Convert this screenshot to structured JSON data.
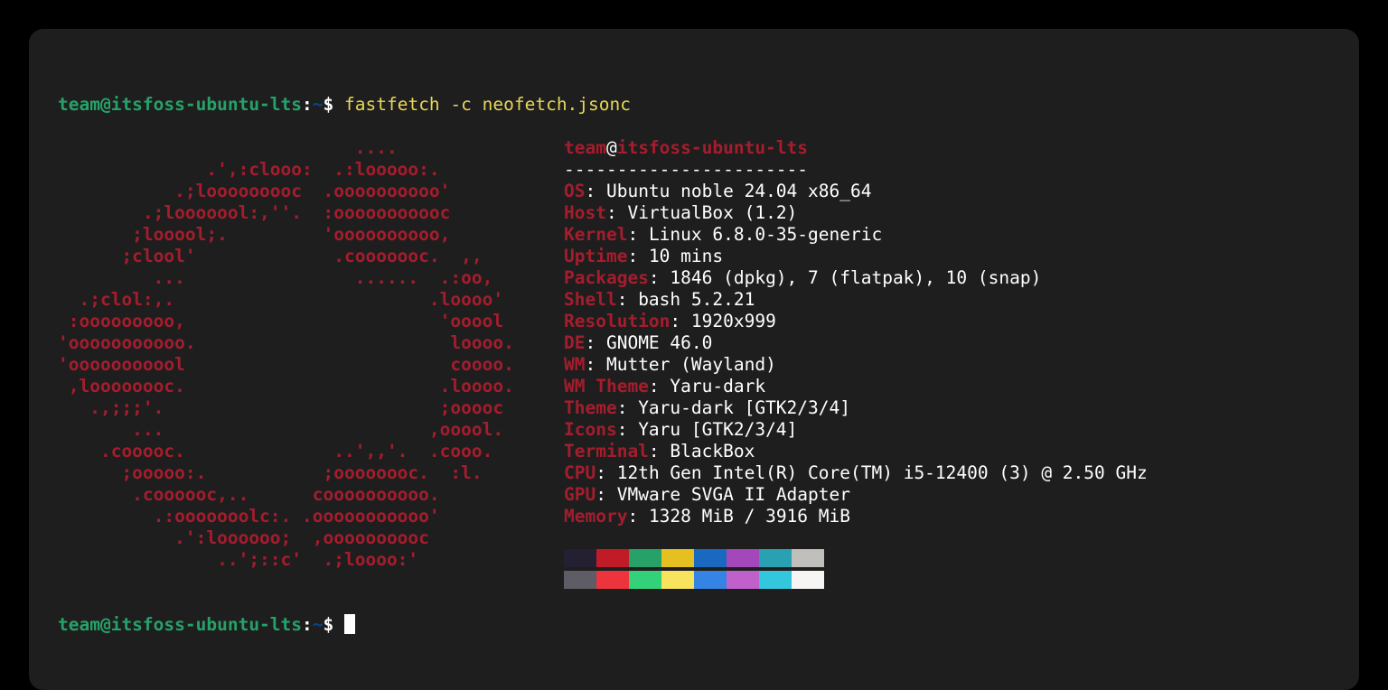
{
  "prompt": {
    "userhost": "team@itsfoss-ubuntu-lts",
    "colon": ":",
    "path": "~",
    "dollar": "$ "
  },
  "command": "fastfetch -c neofetch.jsonc",
  "logo_lines": [
    "                            ....                  ",
    "              .',:clooo:  .:looooo:.              ",
    "           .;looooooooc  .oooooooooo'             ",
    "        .;looooool:,''.  :ooooooooooc             ",
    "       ;looool;.         'oooooooooo,             ",
    "      ;clool'             .cooooooc.  ,,          ",
    "         ...                ......  .:oo,         ",
    "  .;clol:,.                        .loooo'        ",
    " :ooooooooo,                        'ooool        ",
    "'ooooooooooo.                        loooo.       ",
    "'ooooooooool                         coooo.       ",
    " ,loooooooc.                        .loooo.       ",
    "   .,;;;'.                          ;ooooc        ",
    "       ...                         ,ooool.        ",
    "    .cooooc.              ..',,'.  .cooo.         ",
    "      ;ooooo:.           ;oooooooc.  :l.          ",
    "       .coooooc,..      coooooooooo.              ",
    "         .:ooooooolc:. .ooooooooooo'              ",
    "           .':loooooo;  ,oooooooooc               ",
    "               ..';::c'  .;loooo:'                "
  ],
  "header": {
    "user": "team",
    "at": "@",
    "host": "itsfoss-ubuntu-lts"
  },
  "separator": "-----------------------",
  "info": [
    {
      "k": "OS",
      "v": "Ubuntu noble 24.04 x86_64"
    },
    {
      "k": "Host",
      "v": "VirtualBox (1.2)"
    },
    {
      "k": "Kernel",
      "v": "Linux 6.8.0-35-generic"
    },
    {
      "k": "Uptime",
      "v": "10 mins"
    },
    {
      "k": "Packages",
      "v": "1846 (dpkg), 7 (flatpak), 10 (snap)"
    },
    {
      "k": "Shell",
      "v": "bash 5.2.21"
    },
    {
      "k": "Resolution",
      "v": "1920x999"
    },
    {
      "k": "DE",
      "v": "GNOME 46.0"
    },
    {
      "k": "WM",
      "v": "Mutter (Wayland)"
    },
    {
      "k": "WM Theme",
      "v": "Yaru-dark"
    },
    {
      "k": "Theme",
      "v": "Yaru-dark [GTK2/3/4]"
    },
    {
      "k": "Icons",
      "v": "Yaru [GTK2/3/4]"
    },
    {
      "k": "Terminal",
      "v": "BlackBox"
    },
    {
      "k": "CPU",
      "v": "12th Gen Intel(R) Core(TM) i5-12400 (3) @ 2.50 GHz"
    },
    {
      "k": "GPU",
      "v": "VMware SVGA II Adapter"
    },
    {
      "k": "Memory",
      "v": "1328 MiB / 3916 MiB"
    }
  ],
  "swatches_row0": [
    "#241f31",
    "#c01c28",
    "#26a269",
    "#e5c020",
    "#1969c1",
    "#a347ba",
    "#2aa1b3",
    "#c0bfbc"
  ],
  "swatches_row1": [
    "#5e5c64",
    "#ed333b",
    "#33d17a",
    "#f8e45c",
    "#3584e4",
    "#c061cb",
    "#33c7de",
    "#f6f5f4"
  ]
}
